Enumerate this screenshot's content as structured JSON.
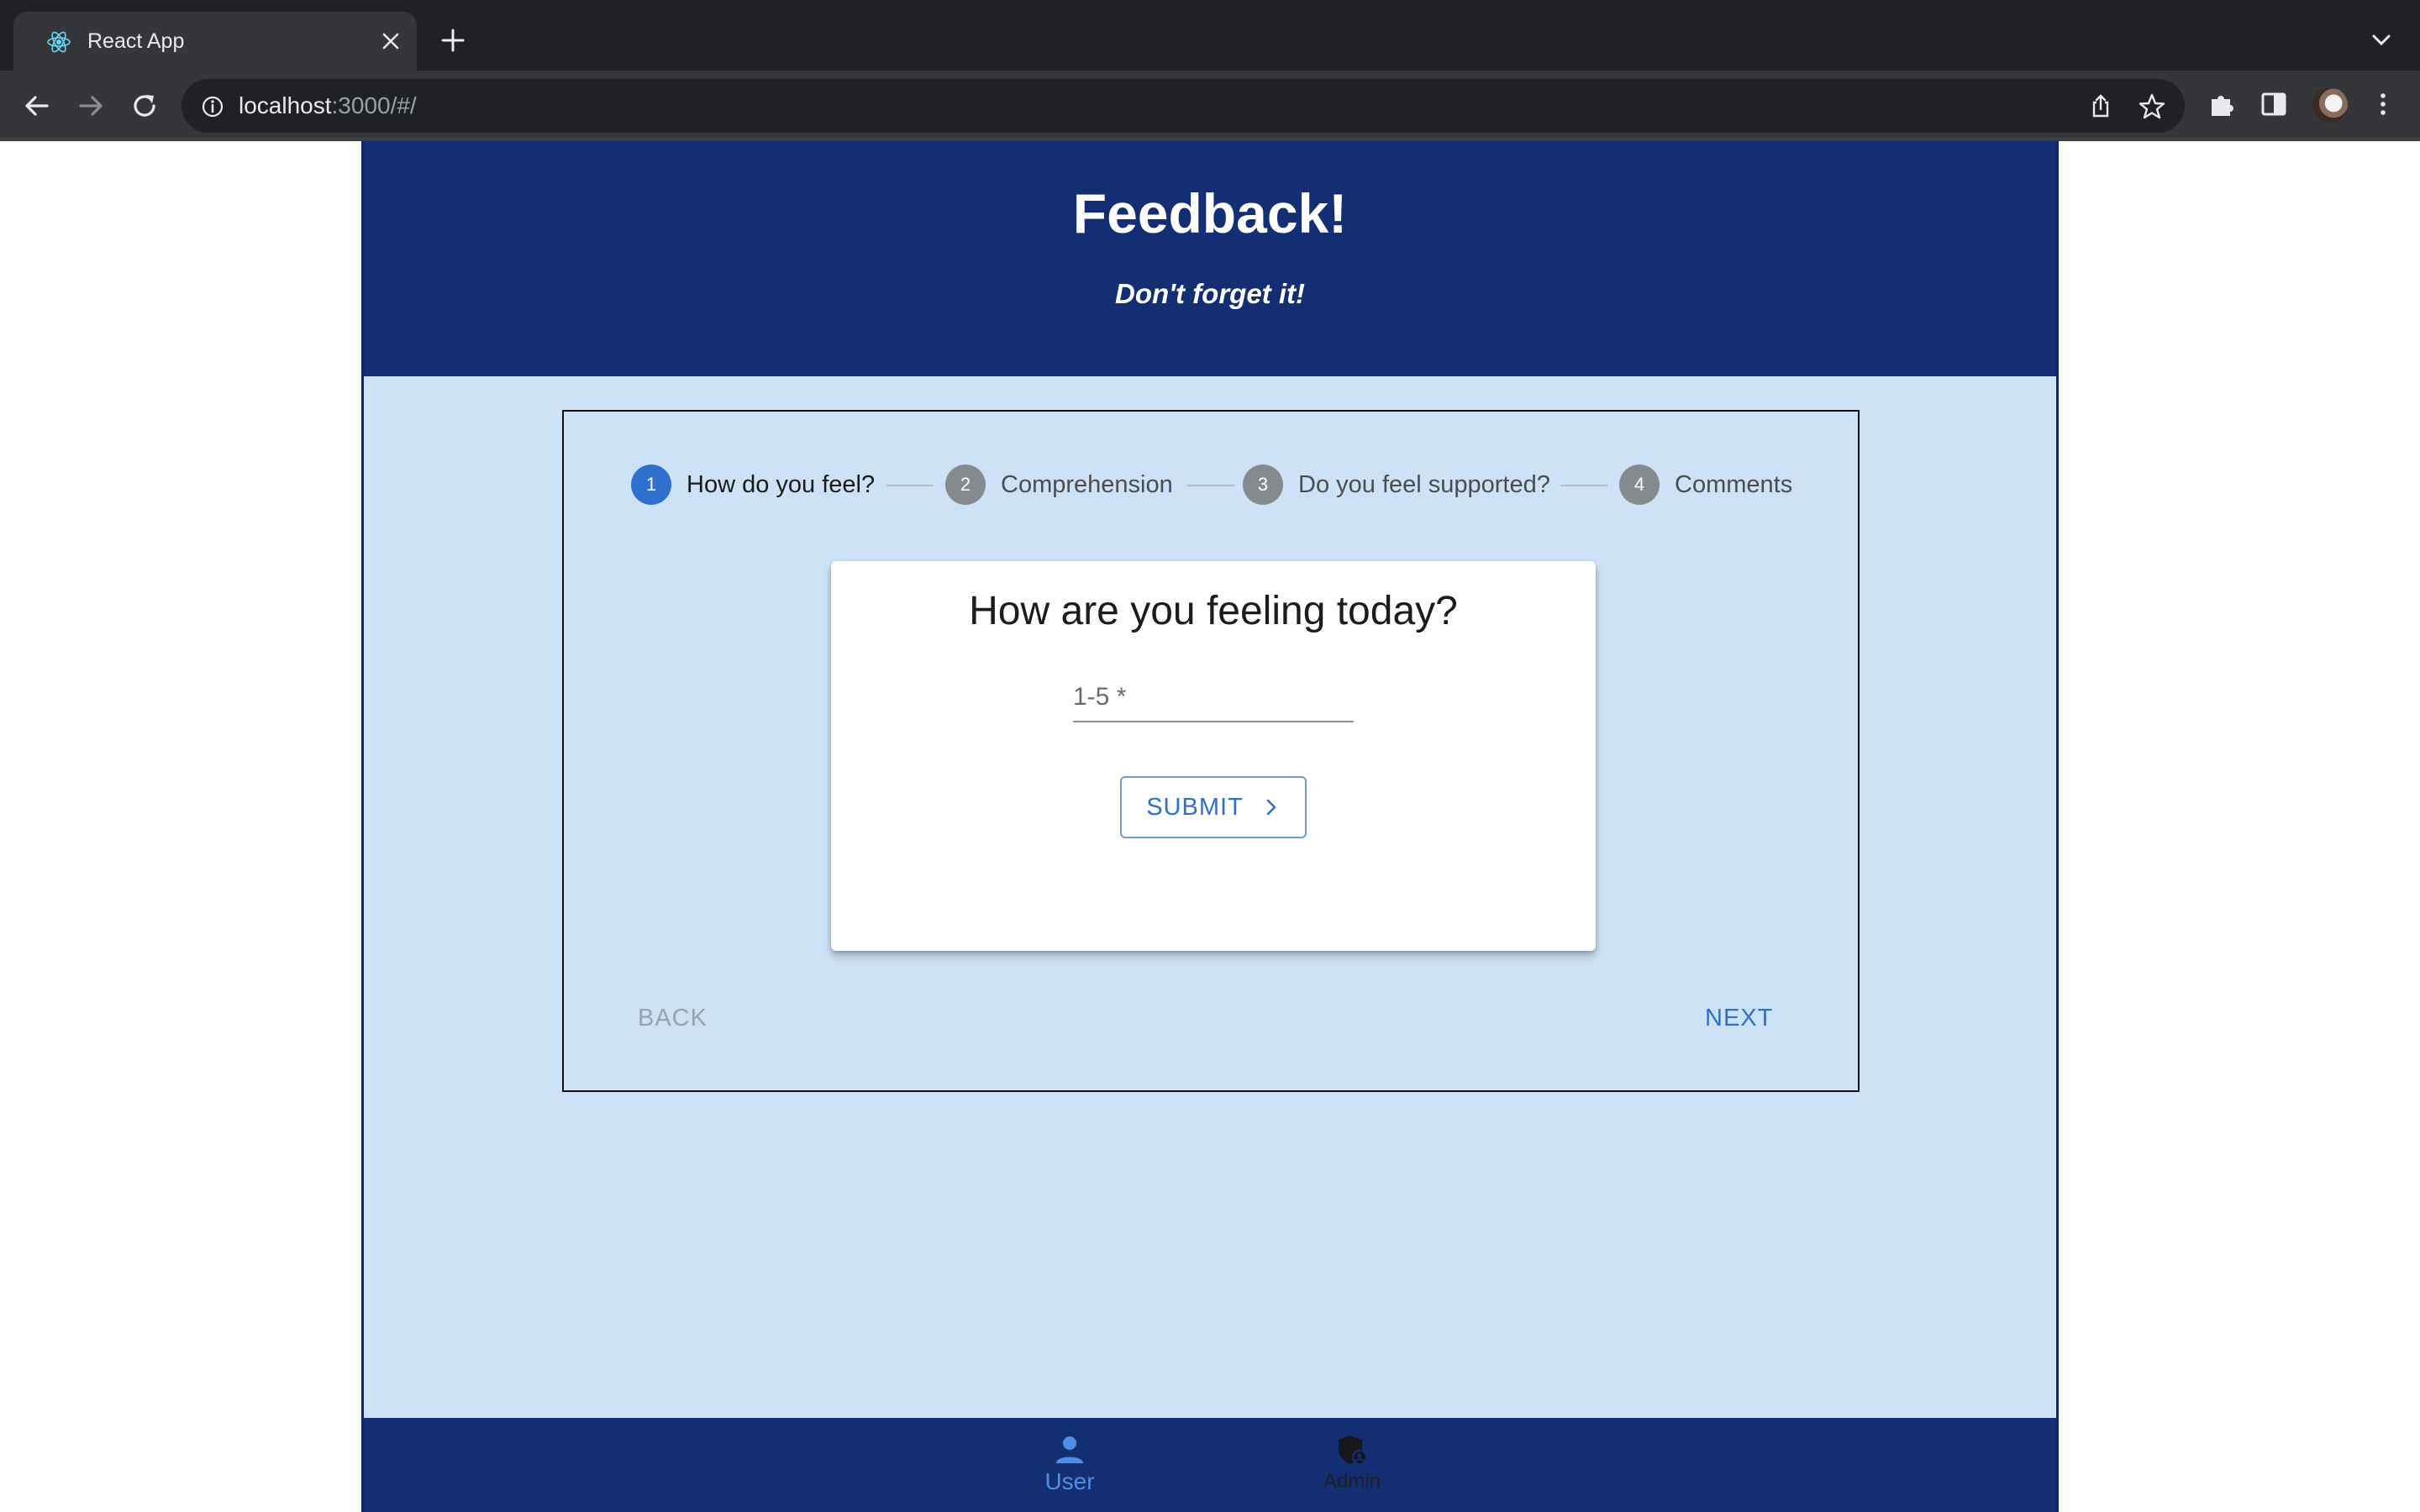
{
  "browser": {
    "tab_title": "React App",
    "url_host": "localhost",
    "url_rest": ":3000/#/"
  },
  "header": {
    "title": "Feedback!",
    "subtitle": "Don't forget it!"
  },
  "stepper": {
    "steps": [
      {
        "number": "1",
        "label": "How do you feel?",
        "active": true
      },
      {
        "number": "2",
        "label": "Comprehension",
        "active": false
      },
      {
        "number": "3",
        "label": "Do you feel supported?",
        "active": false
      },
      {
        "number": "4",
        "label": "Comments",
        "active": false
      }
    ]
  },
  "card": {
    "question": "How are you feeling today?",
    "input_placeholder": "1-5 *",
    "input_value": "",
    "submit_label": "SUBMIT"
  },
  "nav": {
    "back_label": "BACK",
    "next_label": "NEXT"
  },
  "bottom_nav": {
    "items": [
      {
        "label": "User",
        "icon": "person-icon",
        "active": true
      },
      {
        "label": "Admin",
        "icon": "admin-shield-icon",
        "active": false
      }
    ]
  },
  "colors": {
    "header_bg": "#132e72",
    "page_bg": "#cde2f6",
    "accent": "#2f6fce",
    "inactive_step": "#868a8e"
  }
}
